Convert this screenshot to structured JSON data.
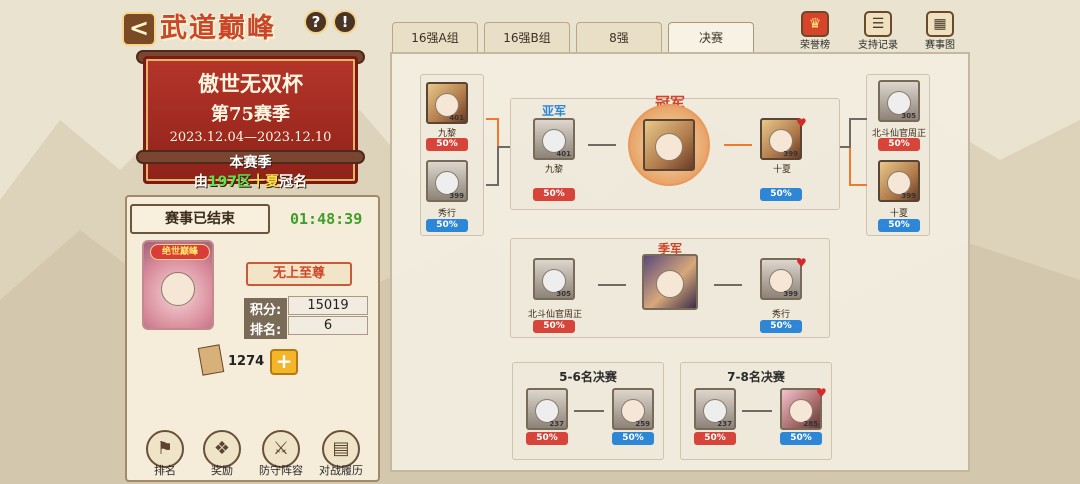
{
  "header": {
    "title": "武道巅峰",
    "help_glyph": "?",
    "info_glyph": "!",
    "tabs": [
      "16强A组",
      "16强B组",
      "8强",
      "决赛"
    ],
    "active_tab": "决赛",
    "top_buttons": [
      {
        "label": "荣誉榜",
        "icon": "trophy-icon"
      },
      {
        "label": "支持记录",
        "icon": "scroll-icon"
      },
      {
        "label": "赛事图",
        "icon": "map-icon"
      }
    ]
  },
  "banner": {
    "cup": "傲世无双杯",
    "season": "第75赛季",
    "dates": "2023.12.04—2023.12.10",
    "line1": "本赛季",
    "line2_prefix": "由",
    "line2_server": "197区",
    "line2_name": "十夏",
    "line2_suffix": "冠名"
  },
  "status": {
    "label": "赛事已结束",
    "timer": "01:48:39",
    "rank_badge": "绝世巅峰",
    "title_badge": "无上至尊",
    "score_label": "积分:",
    "score": "15019",
    "rank_label": "排名:",
    "rank": "6",
    "currency": "1274",
    "plus": "+"
  },
  "bottom_nav": [
    "排名",
    "奖励",
    "防守阵容",
    "对战履历"
  ],
  "bracket": {
    "left_top": {
      "name": "九黎",
      "level": "401",
      "pct": "50%"
    },
    "left_bottom": {
      "name": "秀行",
      "level": "399",
      "pct": "50%"
    },
    "runner_up_label": "亚军",
    "runner_up": {
      "name": "九黎",
      "level": "401",
      "pct": "50%"
    },
    "champion_label": "冠军",
    "finalist": {
      "name": "十夏",
      "level": "399",
      "pct": "50%"
    },
    "right_top": {
      "name": "北斗仙官周正",
      "level": "305",
      "pct": "50%"
    },
    "right_bottom": {
      "name": "十夏",
      "level": "399",
      "pct": "50%"
    },
    "third_label": "季军",
    "third_left": {
      "name": "北斗仙官周正",
      "level": "305",
      "pct": "50%"
    },
    "third_right": {
      "name": "秀行",
      "level": "399",
      "pct": "50%"
    },
    "fifth_label": "5-6名决赛",
    "fifth_left": {
      "level": "237",
      "pct": "50%"
    },
    "fifth_right": {
      "level": "259",
      "pct": "50%"
    },
    "seventh_label": "7-8名决赛",
    "seventh_left": {
      "level": "237",
      "pct": "50%"
    },
    "seventh_right": {
      "level": "285",
      "pct": "50%"
    }
  }
}
